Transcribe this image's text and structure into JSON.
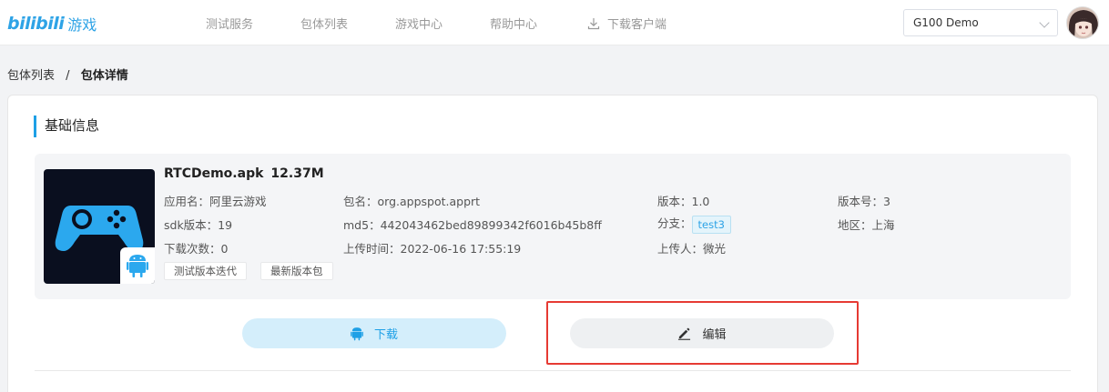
{
  "header": {
    "logo_mark": "bilibili",
    "logo_text": "游戏",
    "nav": [
      {
        "label": "测试服务"
      },
      {
        "label": "包体列表"
      },
      {
        "label": "游戏中心"
      },
      {
        "label": "帮助中心"
      },
      {
        "label": "下载客户端",
        "icon": "download-icon"
      }
    ],
    "project_select": "G100 Demo"
  },
  "breadcrumb": {
    "parent": "包体列表",
    "separator": "/",
    "current": "包体详情"
  },
  "section": {
    "title": "基础信息"
  },
  "package": {
    "file_name": "RTCDemo.apk",
    "file_size": "12.37M",
    "app_name": "应用名：阿里云游戏",
    "sdk_version": "sdk版本：19",
    "download_count": "下载次数：0",
    "package_name": "包名：org.appspot.apprt",
    "md5": "md5：442043462bed89899342f6016b45b8ff",
    "upload_time": "上传时间：2022-06-16 17:55:19",
    "version": "版本：1.0",
    "branch_label": "分支：",
    "branch_value": "test3",
    "uploader": "上传人：微光",
    "version_code": "版本号：3",
    "region": "地区：上海",
    "tags": [
      "测试版本迭代",
      "最新版本包"
    ]
  },
  "actions": {
    "download_label": "下载",
    "edit_label": "编辑"
  },
  "colors": {
    "accent": "#1ea0e6",
    "highlight": "#e63a33"
  }
}
